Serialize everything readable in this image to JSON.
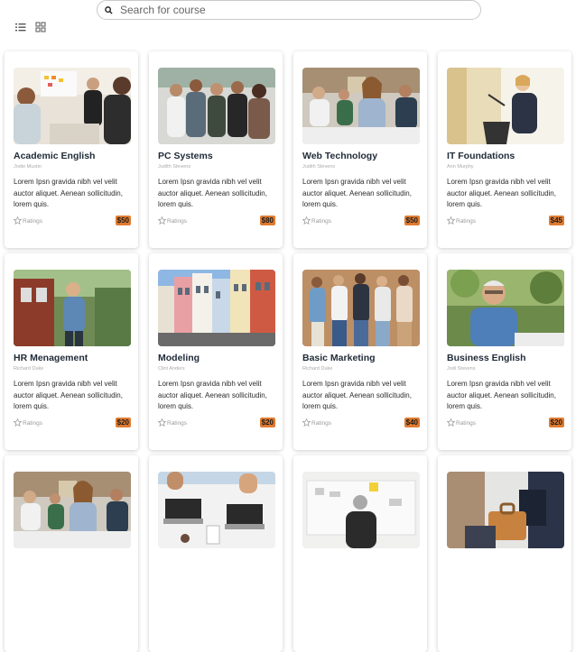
{
  "search": {
    "placeholder": "Search for course",
    "value": ""
  },
  "view_toggle": {
    "list_icon": "list-view-icon",
    "grid_icon": "grid-view-icon"
  },
  "rating_label": "Ratings",
  "courses": [
    {
      "title": "Academic English",
      "author": "Jodie Mustin",
      "description": "Lorem Ipsn gravida nibh vel velit auctor aliquet. Aenean sollicitudin, lorem quis.",
      "price": "$50",
      "image": "classroom-presentation"
    },
    {
      "title": "PC Systems",
      "author": "Judith Stevens",
      "description": "Lorem Ipsn gravida nibh vel velit auctor aliquet. Aenean sollicitudin, lorem quis.",
      "price": "$80",
      "image": "group-of-students"
    },
    {
      "title": "Web Technology",
      "author": "Judith Stevens",
      "description": "Lorem Ipsn gravida nibh vel velit auctor aliquet. Aenean sollicitudin, lorem quis.",
      "price": "$50",
      "image": "students-at-desks"
    },
    {
      "title": "IT Foundations",
      "author": "Ann Murphy",
      "description": "Lorem Ipsn gravida nibh vel velit auctor aliquet. Aenean sollicitudin, lorem quis.",
      "price": "$45",
      "image": "speaker-at-podium"
    },
    {
      "title": "HR Menagement",
      "author": "Richard Duke",
      "description": "Lorem Ipsn gravida nibh vel velit auctor aliquet. Aenean sollicitudin, lorem quis.",
      "price": "$20",
      "image": "man-by-brick-house"
    },
    {
      "title": "Modeling",
      "author": "Clint Anders",
      "description": "Lorem Ipsn gravida nibh vel velit auctor aliquet. Aenean sollicitudin, lorem quis.",
      "price": "$20",
      "image": "colorful-row-houses"
    },
    {
      "title": "Basic Marketing",
      "author": "Richard Duke",
      "description": "Lorem Ipsn gravida nibh vel velit auctor aliquet. Aenean sollicitudin, lorem quis.",
      "price": "$40",
      "image": "people-with-phones"
    },
    {
      "title": "Business English",
      "author": "Jodi Stevens",
      "description": "Lorem Ipsn gravida nibh vel velit auctor aliquet. Aenean sollicitudin, lorem quis.",
      "price": "$20",
      "image": "smiling-older-man"
    },
    {
      "title": "",
      "author": "",
      "description": "",
      "price": "",
      "image": "students-at-desks"
    },
    {
      "title": "",
      "author": "",
      "description": "",
      "price": "",
      "image": "laptops-on-table"
    },
    {
      "title": "",
      "author": "",
      "description": "",
      "price": "",
      "image": "man-at-whiteboard"
    },
    {
      "title": "",
      "author": "",
      "description": "",
      "price": "",
      "image": "businessman-with-briefcase"
    }
  ]
}
